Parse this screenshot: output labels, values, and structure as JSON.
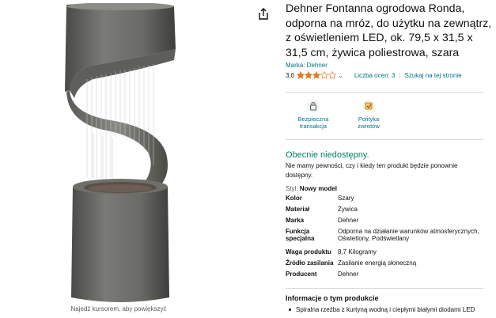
{
  "image_panel": {
    "zoom_hint": "Najedź kursorem, aby powiększyć"
  },
  "product": {
    "title": "Dehner Fontanna ogrodowa Ronda, odporna na mróz, do użytku na zewnątrz, z oświetleniem LED, ok. 79,5 x 31,5 x 31,5 cm, żywica poliestrowa, szara",
    "brand_label": "Marka: Dehner",
    "rating_value": "3,0",
    "rating_stars": 3,
    "rating_max": 5,
    "rating_count": "Liczba ocen: 3",
    "search_link": "Szukaj na tej stronie",
    "star_color": "#de7921"
  },
  "badges": [
    {
      "icon": "lock-icon",
      "label_line1": "Bezpieczna",
      "label_line2": "transakcja"
    },
    {
      "icon": "return-policy-icon",
      "label_line1": "Polityka",
      "label_line2": "zwrotów"
    }
  ],
  "availability": {
    "status": "Obecnie niedostępny.",
    "note": "Nie mamy pewności, czy i kiedy ten produkt będzie ponownie dostępny.",
    "status_color": "#067d62"
  },
  "style": {
    "label": "Styl:",
    "value": "Nowy model"
  },
  "specs": [
    {
      "key": "Kolor",
      "value": "Szary"
    },
    {
      "key": "Materiał",
      "value": "Żywica"
    },
    {
      "key": "Marka",
      "value": "Dehner"
    },
    {
      "key": "Funkcja specjalna",
      "value": "Odporna na działanie warunków atmosferycznych, Oświetlony, Podświetlany"
    },
    {
      "key": "Waga produktu",
      "value": "8,7 Kilogramy"
    },
    {
      "key": "Źródło zasilania",
      "value": "Zasilanie energią słoneczną"
    },
    {
      "key": "Producent",
      "value": "Dehner"
    }
  ],
  "info": {
    "title": "Informacje o tym produkcie",
    "bullets": [
      "Spiralna rzeźba z kurtyną wodną i ciepłymi białymi diodami LED"
    ]
  }
}
